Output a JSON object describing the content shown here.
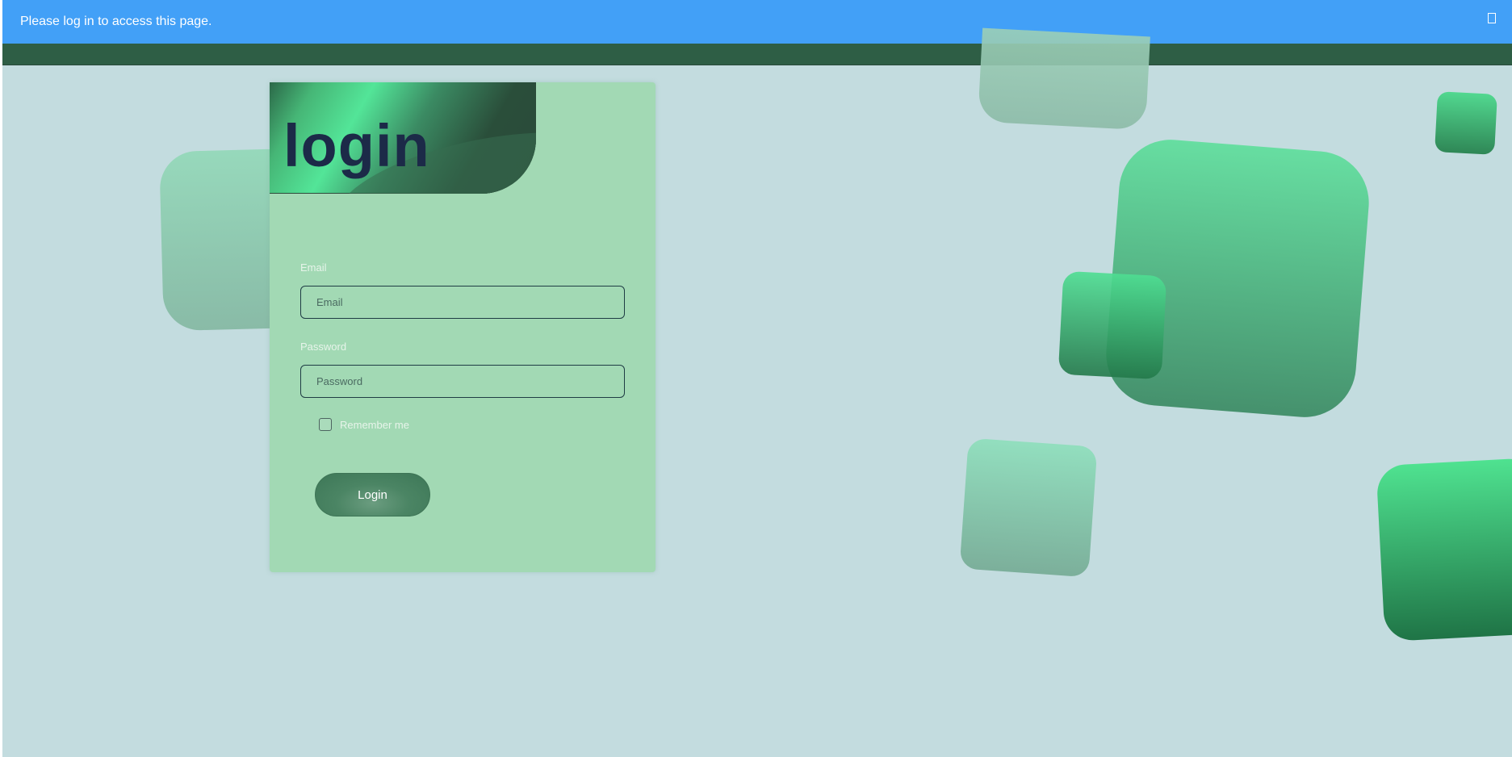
{
  "alert": {
    "message": "Please log in to access this page.",
    "close_icon": "close-icon",
    "background_color": "#42a0f7"
  },
  "navbar": {
    "background_color": "#2e5e45"
  },
  "login_form": {
    "title": "login",
    "email": {
      "label": "Email",
      "placeholder": "Email",
      "value": ""
    },
    "password": {
      "label": "Password",
      "placeholder": "Password",
      "value": ""
    },
    "remember_me": {
      "label": "Remember me",
      "checked": false
    },
    "submit_label": "Login"
  },
  "colors": {
    "page_background": "#c3dcdf",
    "card_background": "#a2d9b4",
    "title_color": "#1c2a48",
    "button_color": "#4b8564",
    "accent_green": "#53e598"
  }
}
